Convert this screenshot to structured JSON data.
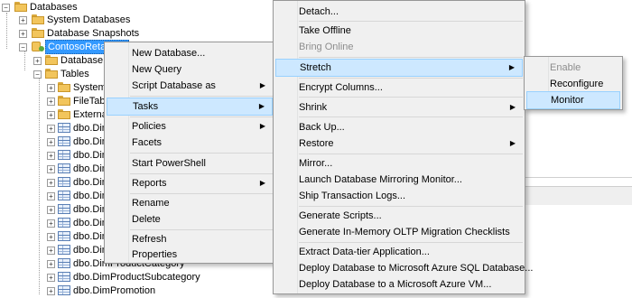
{
  "tree": {
    "databases": "Databases",
    "system_databases": "System Databases",
    "database_snapshots": "Database Snapshots",
    "selected_db": "ContosoRetailDW",
    "database_diagrams": "Database Di",
    "tables": "Tables",
    "system_tables": "System T",
    "filetables": "FileTable",
    "external": "External",
    "dim_rows": [
      "dbo.Dim",
      "dbo.Dim",
      "dbo.Dim",
      "dbo.Dim",
      "dbo.Dim",
      "dbo.Dim",
      "dbo.Dim",
      "dbo.Dim",
      "dbo.Dim",
      "dbo.Dim",
      "dbo.Dim"
    ],
    "product_category": "dbo.DimProductCategory",
    "product_subcategory": "dbo.DimProductSubcategory",
    "promotion": "dbo.DimPromotion"
  },
  "menu1": {
    "new_database": "New Database...",
    "new_query": "New Query",
    "script_database_as": "Script Database as",
    "tasks": "Tasks",
    "policies": "Policies",
    "facets": "Facets",
    "start_powershell": "Start PowerShell",
    "reports": "Reports",
    "rename": "Rename",
    "delete": "Delete",
    "refresh": "Refresh",
    "properties": "Properties"
  },
  "menu2": {
    "detach": "Detach...",
    "take_offline": "Take Offline",
    "bring_online": "Bring Online",
    "stretch": "Stretch",
    "encrypt_columns": "Encrypt Columns...",
    "shrink": "Shrink",
    "back_up": "Back Up...",
    "restore": "Restore",
    "mirror": "Mirror...",
    "launch_mirroring_monitor": "Launch Database Mirroring Monitor...",
    "ship_transaction_logs": "Ship Transaction Logs...",
    "generate_scripts": "Generate Scripts...",
    "generate_inmemory": "Generate In-Memory OLTP Migration Checklists",
    "extract_data_tier": "Extract Data-tier Application...",
    "deploy_azure_sql": "Deploy Database to Microsoft Azure SQL Database...",
    "deploy_azure_vm": "Deploy Database to a Microsoft Azure VM..."
  },
  "menu3": {
    "enable": "Enable",
    "reconfigure": "Reconfigure",
    "monitor": "Monitor"
  },
  "glyphs": {
    "expand": "+",
    "collapse": "−",
    "submenu_arrow": "▶"
  }
}
